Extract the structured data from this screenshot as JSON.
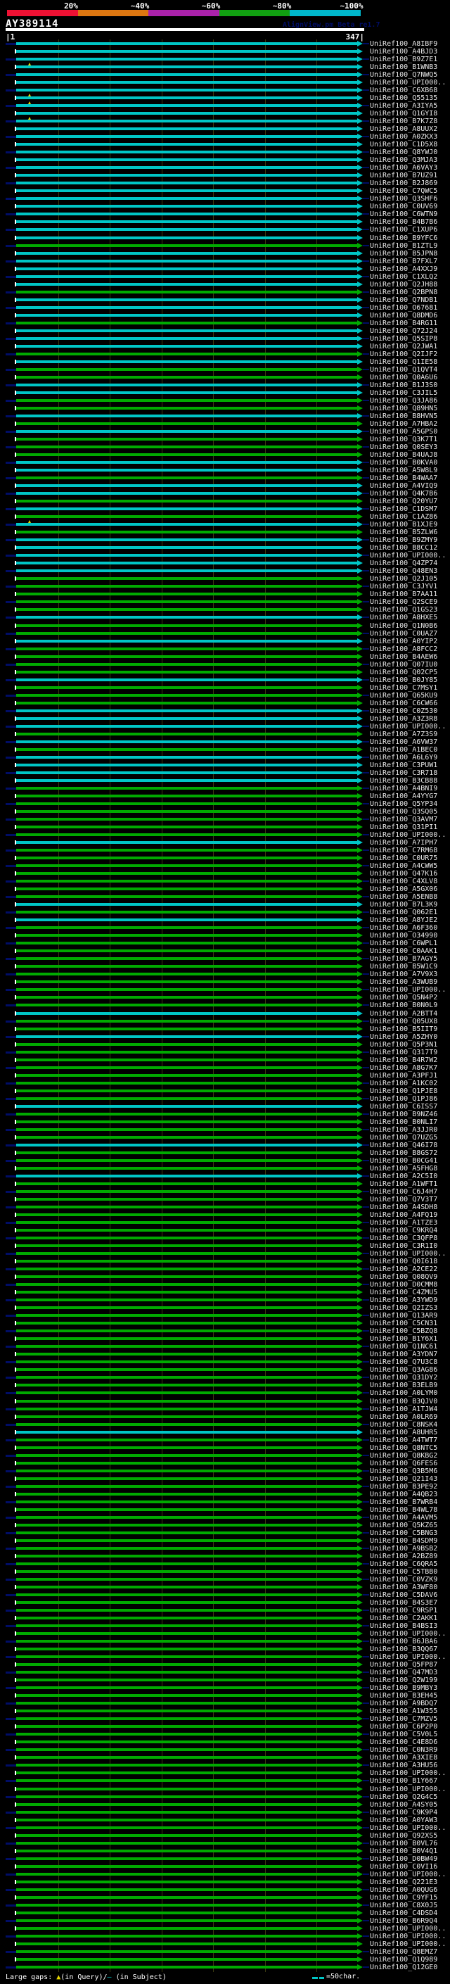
{
  "header": {
    "scale_labels": [
      "20%",
      "~40%",
      "~60%",
      "~80%",
      "~100%"
    ],
    "scale_colors": [
      "#ee1133",
      "#dd7711",
      "#aa22aa",
      "#11a011",
      "#00b8cc"
    ],
    "query_name": "AY389114",
    "watermark": "AlignView.pm Beta re1.7",
    "ruler_start": "|1",
    "ruler_end": "347|"
  },
  "footer": {
    "gaps_prefix": "Large gaps: ",
    "gap_query_marker": "▲",
    "gaps_mid": "(in Query)/",
    "gap_subject_marker": "—",
    "gaps_suffix": " (in Subject)",
    "legend_text": "=50char."
  },
  "colors": {
    "cyan_hit": "#00c6c6",
    "green_hit": "#00aa00",
    "navy": "#000d66",
    "gap_marker_yellow": "#e8d800",
    "gridline": "#3a3a10",
    "label_text": "#e8e8e8",
    "watermark_navy": "#000d66"
  },
  "gap_markers": [
    {
      "row_index": 3,
      "x": 40
    },
    {
      "row_index": 7,
      "x": 40
    },
    {
      "row_index": 8,
      "x": 40
    },
    {
      "row_index": 10,
      "x": 40
    },
    {
      "row_index": 62,
      "x": 40
    }
  ],
  "chart_data": {
    "type": "table",
    "title": "AY389114",
    "query_range": [
      1,
      347
    ],
    "identity_bins": {
      "80-100%": "cyan_hit",
      "60-80%": "green_hit"
    },
    "columns": [
      "subject_id",
      "identity_bin"
    ],
    "rows": [
      [
        "UniRef100_A8IBF9",
        "80-100%"
      ],
      [
        "UniRef100_A4BJD3",
        "80-100%"
      ],
      [
        "UniRef100_B9Z7E1",
        "80-100%"
      ],
      [
        "UniRef100_B1WNB3",
        "80-100%"
      ],
      [
        "UniRef100_Q7NWQ5",
        "80-100%"
      ],
      [
        "UniRef100_UPI000..",
        "80-100%"
      ],
      [
        "UniRef100_C6XB68",
        "80-100%"
      ],
      [
        "UniRef100_Q55135",
        "80-100%"
      ],
      [
        "UniRef100_A3IYA5",
        "80-100%"
      ],
      [
        "UniRef100_Q1GYI8",
        "80-100%"
      ],
      [
        "UniRef100_B7K7Z8",
        "80-100%"
      ],
      [
        "UniRef100_A8UUX2",
        "80-100%"
      ],
      [
        "UniRef100_A0ZKX3",
        "80-100%"
      ],
      [
        "UniRef100_C1D5X8",
        "80-100%"
      ],
      [
        "UniRef100_Q8YWJ0",
        "80-100%"
      ],
      [
        "UniRef100_Q3MJA3",
        "80-100%"
      ],
      [
        "UniRef100_A6VAY3",
        "80-100%"
      ],
      [
        "UniRef100_B7UZ91",
        "80-100%"
      ],
      [
        "UniRef100_B2J869",
        "80-100%"
      ],
      [
        "UniRef100_C7QWC5",
        "80-100%"
      ],
      [
        "UniRef100_Q3SHF6",
        "80-100%"
      ],
      [
        "UniRef100_C0UV69",
        "80-100%"
      ],
      [
        "UniRef100_C6WTN9",
        "80-100%"
      ],
      [
        "UniRef100_B4B7B6",
        "80-100%"
      ],
      [
        "UniRef100_C1XUP6",
        "80-100%"
      ],
      [
        "UniRef100_B9YFC6",
        "80-100%"
      ],
      [
        "UniRef100_B1ZTL9",
        "60-80%"
      ],
      [
        "UniRef100_B5JPN8",
        "80-100%"
      ],
      [
        "UniRef100_B7FXL7",
        "80-100%"
      ],
      [
        "UniRef100_A4XXJ9",
        "80-100%"
      ],
      [
        "UniRef100_C1XLQ2",
        "80-100%"
      ],
      [
        "UniRef100_Q2JH88",
        "80-100%"
      ],
      [
        "UniRef100_Q2BPN8",
        "60-80%"
      ],
      [
        "UniRef100_Q7NDB1",
        "80-100%"
      ],
      [
        "UniRef100_O67681",
        "80-100%"
      ],
      [
        "UniRef100_Q8DMD6",
        "80-100%"
      ],
      [
        "UniRef100_B4RG11",
        "60-80%"
      ],
      [
        "UniRef100_Q72J24",
        "80-100%"
      ],
      [
        "UniRef100_Q5SIP8",
        "80-100%"
      ],
      [
        "UniRef100_Q2JWA1",
        "80-100%"
      ],
      [
        "UniRef100_Q2IJF2",
        "60-80%"
      ],
      [
        "UniRef100_Q1IE58",
        "80-100%"
      ],
      [
        "UniRef100_Q1QVT4",
        "60-80%"
      ],
      [
        "UniRef100_Q0A6U6",
        "60-80%"
      ],
      [
        "UniRef100_B1J3S0",
        "80-100%"
      ],
      [
        "UniRef100_C3JIL5",
        "80-100%"
      ],
      [
        "UniRef100_Q3JA86",
        "60-80%"
      ],
      [
        "UniRef100_Q89HN5",
        "60-80%"
      ],
      [
        "UniRef100_B8HVN5",
        "80-100%"
      ],
      [
        "UniRef100_A7HBA2",
        "60-80%"
      ],
      [
        "UniRef100_A5GPS0",
        "80-100%"
      ],
      [
        "UniRef100_Q3K7T1",
        "60-80%"
      ],
      [
        "UniRef100_Q0SEY3",
        "60-80%"
      ],
      [
        "UniRef100_B4UAJ8",
        "60-80%"
      ],
      [
        "UniRef100_B0KVA0",
        "80-100%"
      ],
      [
        "UniRef100_A5W8L9",
        "80-100%"
      ],
      [
        "UniRef100_B4WAA7",
        "60-80%"
      ],
      [
        "UniRef100_A4VIQ9",
        "80-100%"
      ],
      [
        "UniRef100_Q4K7B6",
        "80-100%"
      ],
      [
        "UniRef100_Q20YU7",
        "60-80%"
      ],
      [
        "UniRef100_C1DSM7",
        "80-100%"
      ],
      [
        "UniRef100_C1AZ86",
        "60-80%"
      ],
      [
        "UniRef100_B1XJE9",
        "80-100%"
      ],
      [
        "UniRef100_B5ZLW6",
        "60-80%"
      ],
      [
        "UniRef100_B9ZMY9",
        "80-100%"
      ],
      [
        "UniRef100_B8CC12",
        "80-100%"
      ],
      [
        "UniRef100_UPI000..",
        "80-100%"
      ],
      [
        "UniRef100_Q4ZP74",
        "80-100%"
      ],
      [
        "UniRef100_Q48EN3",
        "80-100%"
      ],
      [
        "UniRef100_Q2J105",
        "60-80%"
      ],
      [
        "UniRef100_C3JYV1",
        "60-80%"
      ],
      [
        "UniRef100_B7AA11",
        "60-80%"
      ],
      [
        "UniRef100_Q2SCE9",
        "60-80%"
      ],
      [
        "UniRef100_Q1GS23",
        "60-80%"
      ],
      [
        "UniRef100_A8HXE5",
        "80-100%"
      ],
      [
        "UniRef100_Q1N0B6",
        "60-80%"
      ],
      [
        "UniRef100_C0UAZ7",
        "60-80%"
      ],
      [
        "UniRef100_A0YIP2",
        "80-100%"
      ],
      [
        "UniRef100_A8FCC2",
        "60-80%"
      ],
      [
        "UniRef100_B4AEW6",
        "60-80%"
      ],
      [
        "UniRef100_Q07IU0",
        "60-80%"
      ],
      [
        "UniRef100_Q02CP5",
        "60-80%"
      ],
      [
        "UniRef100_B0JY85",
        "80-100%"
      ],
      [
        "UniRef100_C7MSY1",
        "60-80%"
      ],
      [
        "UniRef100_Q65KU9",
        "60-80%"
      ],
      [
        "UniRef100_C6CW66",
        "60-80%"
      ],
      [
        "UniRef100_C0Z530",
        "80-100%"
      ],
      [
        "UniRef100_A3Z3R8",
        "80-100%"
      ],
      [
        "UniRef100_UPI000..",
        "80-100%"
      ],
      [
        "UniRef100_A7Z3S9",
        "60-80%"
      ],
      [
        "UniRef100_A6VW37",
        "80-100%"
      ],
      [
        "UniRef100_A1BEC0",
        "60-80%"
      ],
      [
        "UniRef100_A6L6Y9",
        "80-100%"
      ],
      [
        "UniRef100_C3PUW1",
        "80-100%"
      ],
      [
        "UniRef100_C3R718",
        "80-100%"
      ],
      [
        "UniRef100_B3CB88",
        "80-100%"
      ],
      [
        "UniRef100_A4BNI9",
        "60-80%"
      ],
      [
        "UniRef100_A4YYG7",
        "60-80%"
      ],
      [
        "UniRef100_Q5YP34",
        "60-80%"
      ],
      [
        "UniRef100_Q3SQ05",
        "60-80%"
      ],
      [
        "UniRef100_Q3AVM7",
        "60-80%"
      ],
      [
        "UniRef100_Q31PI1",
        "60-80%"
      ],
      [
        "UniRef100_UPI000..",
        "60-80%"
      ],
      [
        "UniRef100_A7IPH7",
        "80-100%"
      ],
      [
        "UniRef100_C7RM68",
        "60-80%"
      ],
      [
        "UniRef100_C0UR75",
        "60-80%"
      ],
      [
        "UniRef100_A4CWW5",
        "60-80%"
      ],
      [
        "UniRef100_Q47K16",
        "60-80%"
      ],
      [
        "UniRef100_C4XLV8",
        "60-80%"
      ],
      [
        "UniRef100_A5GX06",
        "60-80%"
      ],
      [
        "UniRef100_A5ENB8",
        "60-80%"
      ],
      [
        "UniRef100_B7L3K9",
        "80-100%"
      ],
      [
        "UniRef100_Q062E1",
        "60-80%"
      ],
      [
        "UniRef100_A8YJE2",
        "80-100%"
      ],
      [
        "UniRef100_A6F360",
        "60-80%"
      ],
      [
        "UniRef100_O34990",
        "60-80%"
      ],
      [
        "UniRef100_C6WPL1",
        "60-80%"
      ],
      [
        "UniRef100_C0AAK1",
        "60-80%"
      ],
      [
        "UniRef100_B7AGY5",
        "60-80%"
      ],
      [
        "UniRef100_B5W1C9",
        "60-80%"
      ],
      [
        "UniRef100_A7V9X3",
        "60-80%"
      ],
      [
        "UniRef100_A3WUB9",
        "60-80%"
      ],
      [
        "UniRef100_UPI000..",
        "60-80%"
      ],
      [
        "UniRef100_Q5N4P2",
        "60-80%"
      ],
      [
        "UniRef100_B0N0L9",
        "60-80%"
      ],
      [
        "UniRef100_A2BTT4",
        "80-100%"
      ],
      [
        "UniRef100_Q05UX8",
        "60-80%"
      ],
      [
        "UniRef100_B5IIT9",
        "60-80%"
      ],
      [
        "UniRef100_A5ZHY0",
        "80-100%"
      ],
      [
        "UniRef100_Q5P3N1",
        "60-80%"
      ],
      [
        "UniRef100_Q317T9",
        "60-80%"
      ],
      [
        "UniRef100_B4R7W2",
        "60-80%"
      ],
      [
        "UniRef100_A8G7K7",
        "60-80%"
      ],
      [
        "UniRef100_A3PFJ1",
        "60-80%"
      ],
      [
        "UniRef100_A1KC02",
        "60-80%"
      ],
      [
        "UniRef100_Q1PJE8",
        "60-80%"
      ],
      [
        "UniRef100_Q1PJ86",
        "60-80%"
      ],
      [
        "UniRef100_C6ISS7",
        "80-100%"
      ],
      [
        "UniRef100_B9NZ46",
        "60-80%"
      ],
      [
        "UniRef100_B0NLI7",
        "60-80%"
      ],
      [
        "UniRef100_A3JJR0",
        "60-80%"
      ],
      [
        "UniRef100_Q7UZG5",
        "60-80%"
      ],
      [
        "UniRef100_Q46I78",
        "80-100%"
      ],
      [
        "UniRef100_B8GS72",
        "60-80%"
      ],
      [
        "UniRef100_B0CG41",
        "60-80%"
      ],
      [
        "UniRef100_A5FHG8",
        "60-80%"
      ],
      [
        "UniRef100_A2C5I0",
        "80-100%"
      ],
      [
        "UniRef100_A1WFT1",
        "60-80%"
      ],
      [
        "UniRef100_C6J4H7",
        "60-80%"
      ],
      [
        "UniRef100_Q7V3T7",
        "60-80%"
      ],
      [
        "UniRef100_A4SDH8",
        "60-80%"
      ],
      [
        "UniRef100_A4FQ19",
        "60-80%"
      ],
      [
        "UniRef100_A1TZE3",
        "60-80%"
      ],
      [
        "UniRef100_C9KRQ4",
        "60-80%"
      ],
      [
        "UniRef100_C3QFP8",
        "60-80%"
      ],
      [
        "UniRef100_C3R1I0",
        "60-80%"
      ],
      [
        "UniRef100_UPI000..",
        "60-80%"
      ],
      [
        "UniRef100_Q0I618",
        "60-80%"
      ],
      [
        "UniRef100_A2CE22",
        "60-80%"
      ],
      [
        "UniRef100_Q08QV9",
        "60-80%"
      ],
      [
        "UniRef100_D0CMM8",
        "60-80%"
      ],
      [
        "UniRef100_C4ZMU5",
        "60-80%"
      ],
      [
        "UniRef100_A3YWD9",
        "60-80%"
      ],
      [
        "UniRef100_Q2IZS3",
        "60-80%"
      ],
      [
        "UniRef100_Q13AR9",
        "60-80%"
      ],
      [
        "UniRef100_C5CN31",
        "60-80%"
      ],
      [
        "UniRef100_C5BZQ8",
        "60-80%"
      ],
      [
        "UniRef100_B1Y6X1",
        "60-80%"
      ],
      [
        "UniRef100_Q1NC61",
        "60-80%"
      ],
      [
        "UniRef100_A3YDN7",
        "60-80%"
      ],
      [
        "UniRef100_Q7U3C8",
        "60-80%"
      ],
      [
        "UniRef100_Q3AG86",
        "60-80%"
      ],
      [
        "UniRef100_Q31DY2",
        "60-80%"
      ],
      [
        "UniRef100_B3ELB9",
        "60-80%"
      ],
      [
        "UniRef100_A0LYM0",
        "60-80%"
      ],
      [
        "UniRef100_B3QJV0",
        "60-80%"
      ],
      [
        "UniRef100_A1TJW4",
        "60-80%"
      ],
      [
        "UniRef100_A0LR69",
        "60-80%"
      ],
      [
        "UniRef100_C8NSK4",
        "60-80%"
      ],
      [
        "UniRef100_A8UHR5",
        "80-100%"
      ],
      [
        "UniRef100_A4TWT7",
        "60-80%"
      ],
      [
        "UniRef100_Q8NTC5",
        "60-80%"
      ],
      [
        "UniRef100_Q8KBG2",
        "60-80%"
      ],
      [
        "UniRef100_Q6FES6",
        "60-80%"
      ],
      [
        "UniRef100_Q3B5M6",
        "60-80%"
      ],
      [
        "UniRef100_Q21I43",
        "60-80%"
      ],
      [
        "UniRef100_B3PE92",
        "60-80%"
      ],
      [
        "UniRef100_A4QB23",
        "60-80%"
      ],
      [
        "UniRef100_B7WRB4",
        "60-80%"
      ],
      [
        "UniRef100_B4WL78",
        "60-80%"
      ],
      [
        "UniRef100_A4AVM5",
        "60-80%"
      ],
      [
        "UniRef100_Q5KZ65",
        "60-80%"
      ],
      [
        "UniRef100_C5BNG3",
        "60-80%"
      ],
      [
        "UniRef100_B4SDM9",
        "60-80%"
      ],
      [
        "UniRef100_A9BSB2",
        "60-80%"
      ],
      [
        "UniRef100_A2BZ89",
        "60-80%"
      ],
      [
        "UniRef100_C6QRA5",
        "60-80%"
      ],
      [
        "UniRef100_C5TBB0",
        "60-80%"
      ],
      [
        "UniRef100_C0VZK9",
        "60-80%"
      ],
      [
        "UniRef100_A3WF80",
        "60-80%"
      ],
      [
        "UniRef100_C5DAV6",
        "60-80%"
      ],
      [
        "UniRef100_B4S3E7",
        "60-80%"
      ],
      [
        "UniRef100_C9RSP1",
        "60-80%"
      ],
      [
        "UniRef100_C2AKK1",
        "60-80%"
      ],
      [
        "UniRef100_B4BSI3",
        "60-80%"
      ],
      [
        "UniRef100_UPI000..",
        "60-80%"
      ],
      [
        "UniRef100_B6JBA6",
        "60-80%"
      ],
      [
        "UniRef100_B3QQ67",
        "60-80%"
      ],
      [
        "UniRef100_UPI000..",
        "60-80%"
      ],
      [
        "UniRef100_Q5FP87",
        "60-80%"
      ],
      [
        "UniRef100_Q47MD3",
        "60-80%"
      ],
      [
        "UniRef100_Q2W199",
        "60-80%"
      ],
      [
        "UniRef100_B9MBY3",
        "60-80%"
      ],
      [
        "UniRef100_B3EH45",
        "60-80%"
      ],
      [
        "UniRef100_A9BDQ7",
        "60-80%"
      ],
      [
        "UniRef100_A1W355",
        "60-80%"
      ],
      [
        "UniRef100_C7MZV5",
        "60-80%"
      ],
      [
        "UniRef100_C6P2P0",
        "60-80%"
      ],
      [
        "UniRef100_C5V0L5",
        "60-80%"
      ],
      [
        "UniRef100_C4E8D6",
        "60-80%"
      ],
      [
        "UniRef100_C0N3R9",
        "60-80%"
      ],
      [
        "UniRef100_A3XIE8",
        "60-80%"
      ],
      [
        "UniRef100_A3HU56",
        "60-80%"
      ],
      [
        "UniRef100_UPI000..",
        "60-80%"
      ],
      [
        "UniRef100_B1Y667",
        "60-80%"
      ],
      [
        "UniRef100_UPI000..",
        "60-80%"
      ],
      [
        "UniRef100_Q2G4C5",
        "60-80%"
      ],
      [
        "UniRef100_A4SY05",
        "60-80%"
      ],
      [
        "UniRef100_C9K9P4",
        "60-80%"
      ],
      [
        "UniRef100_A0YAW3",
        "60-80%"
      ],
      [
        "UniRef100_UPI000..",
        "60-80%"
      ],
      [
        "UniRef100_Q92XS5",
        "60-80%"
      ],
      [
        "UniRef100_B0VL76",
        "60-80%"
      ],
      [
        "UniRef100_B0V4Q1",
        "60-80%"
      ],
      [
        "UniRef100_D0BW49",
        "60-80%"
      ],
      [
        "UniRef100_C0VI16",
        "60-80%"
      ],
      [
        "UniRef100_UPI000..",
        "60-80%"
      ],
      [
        "UniRef100_Q221E3",
        "60-80%"
      ],
      [
        "UniRef100_A0QUG6",
        "60-80%"
      ],
      [
        "UniRef100_C9YF15",
        "60-80%"
      ],
      [
        "UniRef100_C8X0J5",
        "60-80%"
      ],
      [
        "UniRef100_C4DSD4",
        "60-80%"
      ],
      [
        "UniRef100_B6R9Q4",
        "60-80%"
      ],
      [
        "UniRef100_UPI000..",
        "60-80%"
      ],
      [
        "UniRef100_UPI000..",
        "60-80%"
      ],
      [
        "UniRef100_UPI000..",
        "60-80%"
      ],
      [
        "UniRef100_Q8EMZ7",
        "60-80%"
      ],
      [
        "UniRef100_Q1Q989",
        "60-80%"
      ],
      [
        "UniRef100_Q12GE0",
        "60-80%"
      ]
    ]
  }
}
